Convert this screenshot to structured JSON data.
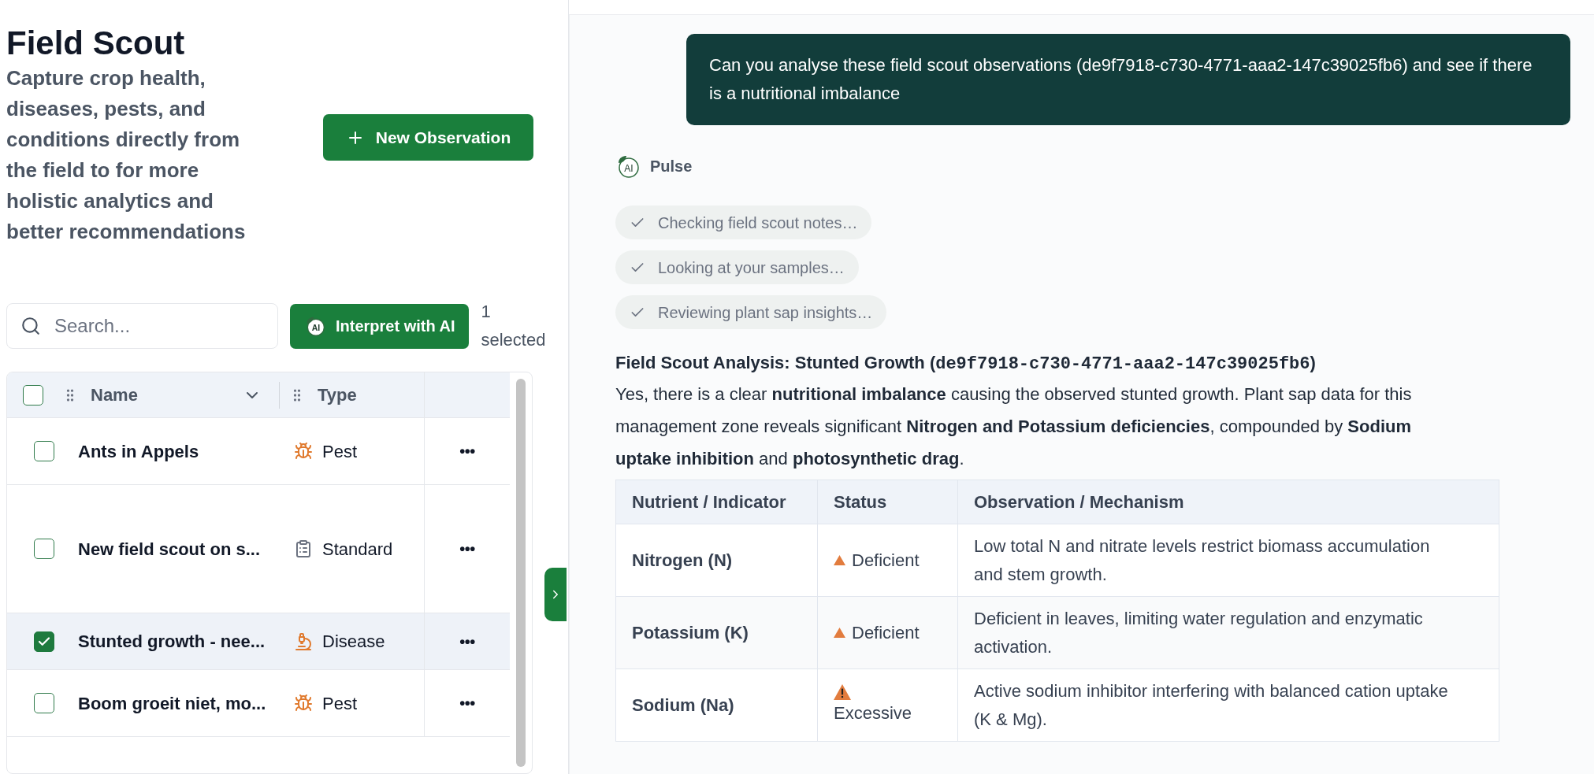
{
  "header": {
    "title": "Field Scout",
    "description": "Capture crop health, diseases, pests, and conditions directly from the field to for more holistic analytics and better recommendations",
    "new_button": "New Observation"
  },
  "toolbar": {
    "search": {
      "placeholder": "Search..."
    },
    "interpret_logo": "AI",
    "interpret_button": "Interpret with AI",
    "selection_count": "1 selected"
  },
  "table": {
    "all_checked": false,
    "columns": [
      "Name",
      "Type"
    ],
    "rows": [
      {
        "name": "Ants in Appels",
        "type": "Pest",
        "kind": "pest",
        "selected": false,
        "actions": "•••"
      },
      {
        "name": "New field scout on s...",
        "type": "Standard",
        "kind": "standard",
        "selected": false,
        "actions": "•••"
      },
      {
        "name": "Stunted growth - nee...",
        "type": "Disease",
        "kind": "disease",
        "selected": true,
        "actions": "•••"
      },
      {
        "name": "Boom groeit niet, mo...",
        "type": "Pest",
        "kind": "pest",
        "selected": false,
        "actions": "•••"
      }
    ]
  },
  "chat": {
    "user_message": "Can you analyse these field scout observations (de9f7918-c730-4771-aaa2-147c39025fb6) and see if there is a nutritional imbalance",
    "assistant_logo": "AI",
    "assistant_name": "Pulse",
    "steps": [
      {
        "label": "Checking field scout notes…",
        "done": true
      },
      {
        "label": "Looking at your samples…",
        "done": true
      },
      {
        "label": "Reviewing plant sap insights…",
        "done": true
      }
    ],
    "heading": {
      "text": "Field Scout Analysis: Stunted Growth (",
      "code": "de9f7918-c730-4771-aaa2-147c39025fb6",
      "close": ")"
    },
    "paragraph": "Yes, there is a clear **nutritional imbalance** causing the observed stunted growth. Plant sap data for this management zone reveals significant **Nitrogen and Potassium deficiencies**, compounded by **Sodium uptake inhibition** and **photosynthetic drag**.",
    "table": {
      "columns": [
        "Nutrient / Indicator",
        "Status",
        "Observation / Mechanism"
      ],
      "rows": [
        {
          "nutrient": "Nitrogen (N)",
          "status": "Deficient",
          "kind": "deficient",
          "observation": "Low total N and nitrate levels restrict biomass accumulation and stem growth."
        },
        {
          "nutrient": "Potassium (K)",
          "status": "Deficient",
          "kind": "deficient",
          "observation": "Deficient in leaves, limiting water regulation and enzymatic activation."
        },
        {
          "nutrient": "Sodium (Na)",
          "status": "Excessive",
          "kind": "excessive",
          "observation": "Active sodium inhibitor interfering with balanced cation uptake (K & Mg)."
        }
      ]
    }
  }
}
